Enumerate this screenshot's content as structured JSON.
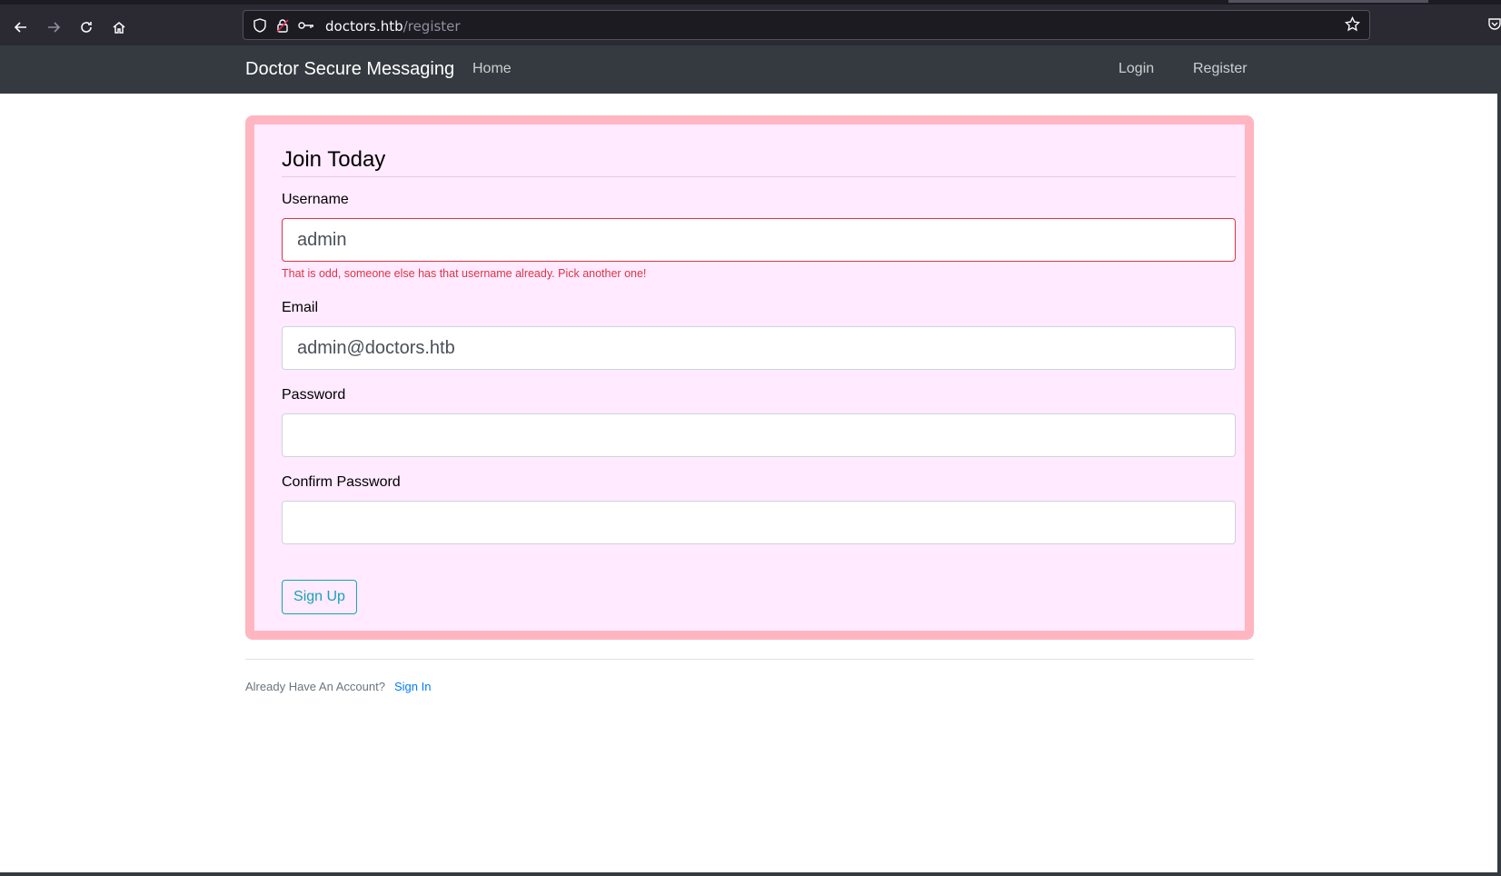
{
  "browser": {
    "url_host": "doctors.htb",
    "url_path": "/register"
  },
  "navbar": {
    "brand": "Doctor Secure Messaging",
    "home": "Home",
    "login": "Login",
    "register": "Register"
  },
  "form": {
    "legend": "Join Today",
    "username_label": "Username",
    "username_value": "admin",
    "username_error": "That is odd, someone else has that username already. Pick another one!",
    "email_label": "Email",
    "email_value": "admin@doctors.htb",
    "password_label": "Password",
    "password_value": "",
    "confirm_label": "Confirm Password",
    "confirm_value": "",
    "submit": "Sign Up"
  },
  "footer": {
    "text": "Already Have An Account?",
    "link": "Sign In"
  },
  "colors": {
    "card_border": "#ffb6c1",
    "card_bg": "#ffeaff",
    "error": "#dc3545",
    "button": "#17a2b8",
    "link": "#007bff",
    "navbar": "#343a40"
  }
}
